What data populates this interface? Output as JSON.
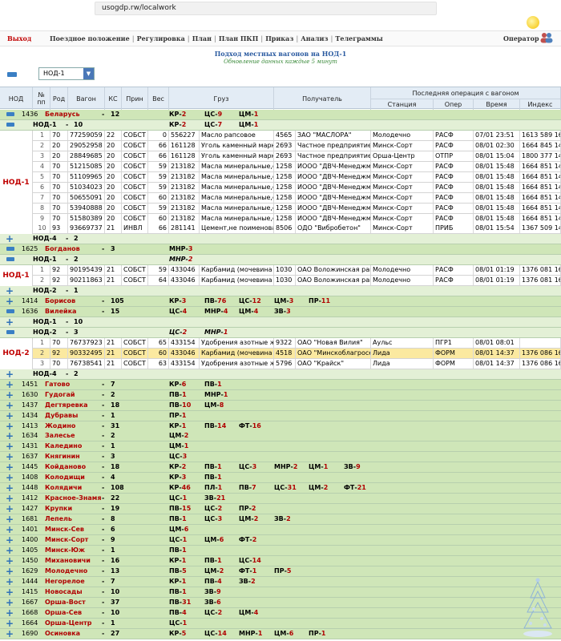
{
  "browser": {
    "url": "usogdp.rw/localwork"
  },
  "menu": {
    "exit": "Выход",
    "items": [
      "Поездное положение",
      "Регулировка",
      "План",
      "План ПКП",
      "Приказ",
      "Анализ",
      "Телеграммы"
    ],
    "operator": "Оператор"
  },
  "header": {
    "title": "Подход местных вагонов на НОД-1",
    "subtitle": "Обновление данных каждые 5 минут",
    "selected_nod": "НОД-1"
  },
  "table": {
    "columns": {
      "nod": "НОД",
      "num": "№ пп",
      "rod": "Род",
      "wagon": "Вагон",
      "ks": "КС",
      "prin": "Прин",
      "ves": "Вес",
      "gruz": "Груз",
      "poluch": "Получатель",
      "last_op": "Последняя операция с вагоном",
      "station": "Станция",
      "oper": "Опер",
      "time": "Время",
      "index": "Индекс"
    }
  },
  "rows": [
    {
      "t": "region",
      "code": "1436",
      "name": "Беларусь",
      "count": "12",
      "ops": [
        {
          "k": "КР",
          "v": "2"
        },
        {
          "k": "ЦС",
          "v": "9"
        },
        {
          "k": "ЦМ",
          "v": "1"
        }
      ],
      "icon": "minus"
    },
    {
      "t": "nodhead",
      "name": "НОД-1",
      "count": "10",
      "ops": [
        {
          "k": "КР",
          "v": "2"
        },
        {
          "k": "ЦС",
          "v": "7"
        },
        {
          "k": "ЦМ",
          "v": "1"
        }
      ],
      "icon": "minus"
    },
    {
      "t": "wag",
      "nod": "НОД-1",
      "n": "1",
      "rod": "70",
      "wagon": "77259059",
      "ks": "22",
      "prin": "СОБСТ",
      "ves": "0",
      "code": "556227",
      "gruz": "Масло рапсовое",
      "pcode": "4565",
      "poluch": "ЗАО \"МАСЛОРА\"",
      "station": "Молодечно",
      "oper": "РАСФ",
      "time": "07/01 23:51",
      "index": "1613 589 16"
    },
    {
      "t": "wag",
      "n": "2",
      "rod": "20",
      "wagon": "29052958",
      "ks": "20",
      "prin": "СОБСТ",
      "ves": "66",
      "code": "161128",
      "gruz": "Уголь каменный марки",
      "pcode": "2693",
      "poluch": "Частное предприятие",
      "station": "Минск-Сорт",
      "oper": "РАСФ",
      "time": "08/01 02:30",
      "index": "1664 845 14"
    },
    {
      "t": "wag",
      "n": "3",
      "rod": "20",
      "wagon": "28849685",
      "ks": "20",
      "prin": "СОБСТ",
      "ves": "66",
      "code": "161128",
      "gruz": "Уголь каменный марки",
      "pcode": "2693",
      "poluch": "Частное предприятие",
      "station": "Орша-Центр",
      "oper": "ОТПР",
      "time": "08/01 15:04",
      "index": "1800 377 14"
    },
    {
      "t": "wag",
      "n": "4",
      "rod": "70",
      "wagon": "51215085",
      "ks": "20",
      "prin": "СОБСТ",
      "ves": "59",
      "code": "213182",
      "gruz": "Масла минеральные,св",
      "pcode": "1258",
      "poluch": "ИООО \"ДВЧ-Менеджме",
      "station": "Минск-Сорт",
      "oper": "РАСФ",
      "time": "08/01 15:48",
      "index": "1664 851 14"
    },
    {
      "t": "wag",
      "n": "5",
      "rod": "70",
      "wagon": "51109965",
      "ks": "20",
      "prin": "СОБСТ",
      "ves": "59",
      "code": "213182",
      "gruz": "Масла минеральные,св",
      "pcode": "1258",
      "poluch": "ИООО \"ДВЧ-Менеджме",
      "station": "Минск-Сорт",
      "oper": "РАСФ",
      "time": "08/01 15:48",
      "index": "1664 851 14"
    },
    {
      "t": "wag",
      "n": "6",
      "rod": "70",
      "wagon": "51034023",
      "ks": "20",
      "prin": "СОБСТ",
      "ves": "59",
      "code": "213182",
      "gruz": "Масла минеральные,св",
      "pcode": "1258",
      "poluch": "ИООО \"ДВЧ-Менеджме",
      "station": "Минск-Сорт",
      "oper": "РАСФ",
      "time": "08/01 15:48",
      "index": "1664 851 14"
    },
    {
      "t": "wag",
      "n": "7",
      "rod": "70",
      "wagon": "50655091",
      "ks": "20",
      "prin": "СОБСТ",
      "ves": "60",
      "code": "213182",
      "gruz": "Масла минеральные,св",
      "pcode": "1258",
      "poluch": "ИООО \"ДВЧ-Менеджме",
      "station": "Минск-Сорт",
      "oper": "РАСФ",
      "time": "08/01 15:48",
      "index": "1664 851 14"
    },
    {
      "t": "wag",
      "n": "8",
      "rod": "70",
      "wagon": "53940888",
      "ks": "20",
      "prin": "СОБСТ",
      "ves": "59",
      "code": "213182",
      "gruz": "Масла минеральные,св",
      "pcode": "1258",
      "poluch": "ИООО \"ДВЧ-Менеджме",
      "station": "Минск-Сорт",
      "oper": "РАСФ",
      "time": "08/01 15:48",
      "index": "1664 851 14"
    },
    {
      "t": "wag",
      "n": "9",
      "rod": "70",
      "wagon": "51580389",
      "ks": "20",
      "prin": "СОБСТ",
      "ves": "60",
      "code": "213182",
      "gruz": "Масла минеральные,св",
      "pcode": "1258",
      "poluch": "ИООО \"ДВЧ-Менеджме",
      "station": "Минск-Сорт",
      "oper": "РАСФ",
      "time": "08/01 15:48",
      "index": "1664 851 14"
    },
    {
      "t": "wag",
      "n": "10",
      "rod": "93",
      "wagon": "93669737",
      "ks": "21",
      "prin": "ИНВЛ",
      "ves": "66",
      "code": "281141",
      "gruz": "Цемент,не поименован",
      "pcode": "8506",
      "poluch": "ОДО \"Вибробетон\"",
      "station": "Минск-Сорт",
      "oper": "ПРИБ",
      "time": "08/01 15:54",
      "index": "1367 509 14"
    },
    {
      "t": "nodhead",
      "name": "НОД-4",
      "count": "2",
      "ops": [],
      "icon": "plus"
    },
    {
      "t": "region",
      "code": "1625",
      "name": "Богданов",
      "count": "3",
      "ops": [
        {
          "k": "МНР",
          "v": "3"
        }
      ],
      "icon": "minus"
    },
    {
      "t": "nodhead",
      "name": "НОД-1",
      "count": "2",
      "ops": [
        {
          "k": "МНР",
          "v": "2",
          "it": true
        }
      ],
      "icon": "minus"
    },
    {
      "t": "wag",
      "nod": "НОД-1",
      "n": "1",
      "rod": "92",
      "wagon": "90195439",
      "ks": "21",
      "prin": "СОБСТ",
      "ves": "59",
      "code": "433046",
      "gruz": "Карбамид (мочевина и",
      "pcode": "1030",
      "poluch": "ОАО Воложинская рай",
      "station": "Молодечно",
      "oper": "РАСФ",
      "time": "08/01 01:19",
      "index": "1376 081 16"
    },
    {
      "t": "wag",
      "n": "2",
      "rod": "92",
      "wagon": "90211863",
      "ks": "21",
      "prin": "СОБСТ",
      "ves": "64",
      "code": "433046",
      "gruz": "Карбамид (мочевина и",
      "pcode": "1030",
      "poluch": "ОАО Воложинская рай",
      "station": "Молодечно",
      "oper": "РАСФ",
      "time": "08/01 01:19",
      "index": "1376 081 16"
    },
    {
      "t": "nodhead",
      "name": "НОД-2",
      "count": "1",
      "ops": [],
      "icon": "plus"
    },
    {
      "t": "region",
      "code": "1414",
      "name": "Борисов",
      "count": "105",
      "ops": [
        {
          "k": "КР",
          "v": "3"
        },
        {
          "k": "ПВ",
          "v": "76"
        },
        {
          "k": "ЦС",
          "v": "12"
        },
        {
          "k": "ЦМ",
          "v": "3"
        },
        {
          "k": "ПР",
          "v": "11"
        }
      ],
      "icon": "plus"
    },
    {
      "t": "region",
      "code": "1636",
      "name": "Вилейка",
      "count": "15",
      "ops": [
        {
          "k": "ЦС",
          "v": "4"
        },
        {
          "k": "МНР",
          "v": "4"
        },
        {
          "k": "ЦМ",
          "v": "4"
        },
        {
          "k": "ЗВ",
          "v": "3"
        }
      ],
      "icon": "minus"
    },
    {
      "t": "nodhead",
      "name": "НОД-1",
      "count": "10",
      "ops": [],
      "icon": "plus"
    },
    {
      "t": "nodhead",
      "name": "НОД-2",
      "count": "3",
      "ops": [
        {
          "k": "ЦС",
          "v": "2",
          "it": true
        },
        {
          "k": "МНР",
          "v": "1",
          "it": true
        }
      ],
      "icon": "minus"
    },
    {
      "t": "wag",
      "nod": "НОД-2",
      "n": "1",
      "rod": "70",
      "wagon": "76737923",
      "ks": "21",
      "prin": "СОБСТ",
      "ves": "65",
      "code": "433154",
      "gruz": "Удобрения азотные жи",
      "pcode": "9322",
      "poluch": "ОАО \"Новая Вилия\"",
      "station": "Аульс",
      "oper": "ПГР1",
      "time": "08/01 08:01",
      "index": ""
    },
    {
      "t": "wag",
      "hl": true,
      "n": "2",
      "rod": "92",
      "wagon": "90332495",
      "ks": "21",
      "prin": "СОБСТ",
      "ves": "60",
      "code": "433046",
      "gruz": "Карбамид (мочевина и",
      "pcode": "4518",
      "poluch": "ОАО \"Минскоблагросе",
      "station": "Лида",
      "oper": "ФОРМ",
      "time": "08/01 14:37",
      "index": "1376 086 16"
    },
    {
      "t": "wag",
      "n": "3",
      "rod": "70",
      "wagon": "76738541",
      "ks": "21",
      "prin": "СОБСТ",
      "ves": "63",
      "code": "433154",
      "gruz": "Удобрения азотные жи",
      "pcode": "5796",
      "poluch": "ОАО \"Крайск\"",
      "station": "Лида",
      "oper": "ФОРМ",
      "time": "08/01 14:37",
      "index": "1376 086 16"
    },
    {
      "t": "nodhead",
      "name": "НОД-4",
      "count": "2",
      "ops": [],
      "icon": "plus"
    },
    {
      "t": "region",
      "code": "1451",
      "name": "Гатово",
      "count": "7",
      "ops": [
        {
          "k": "КР",
          "v": "6"
        },
        {
          "k": "ПВ",
          "v": "1"
        }
      ],
      "icon": "plus"
    },
    {
      "t": "region",
      "code": "1630",
      "name": "Гудогай",
      "count": "2",
      "ops": [
        {
          "k": "ПВ",
          "v": "1"
        },
        {
          "k": "МНР",
          "v": "1"
        }
      ],
      "icon": "plus"
    },
    {
      "t": "region",
      "code": "1437",
      "name": "Дегтяревка",
      "count": "18",
      "ops": [
        {
          "k": "ПВ",
          "v": "10"
        },
        {
          "k": "ЦМ",
          "v": "8"
        }
      ],
      "icon": "plus"
    },
    {
      "t": "region",
      "code": "1434",
      "name": "Дубравы",
      "count": "1",
      "ops": [
        {
          "k": "ПР",
          "v": "1"
        }
      ],
      "icon": "plus"
    },
    {
      "t": "region",
      "code": "1413",
      "name": "Жодино",
      "count": "31",
      "ops": [
        {
          "k": "КР",
          "v": "1"
        },
        {
          "k": "ПВ",
          "v": "14"
        },
        {
          "k": "ФТ",
          "v": "16"
        }
      ],
      "icon": "plus"
    },
    {
      "t": "region",
      "code": "1634",
      "name": "Залесье",
      "count": "2",
      "ops": [
        {
          "k": "ЦМ",
          "v": "2"
        }
      ],
      "icon": "plus"
    },
    {
      "t": "region",
      "code": "1431",
      "name": "Каледино",
      "count": "1",
      "ops": [
        {
          "k": "ЦМ",
          "v": "1"
        }
      ],
      "icon": "plus"
    },
    {
      "t": "region",
      "code": "1637",
      "name": "Княгинин",
      "count": "3",
      "ops": [
        {
          "k": "ЦС",
          "v": "3"
        }
      ],
      "icon": "plus"
    },
    {
      "t": "region",
      "code": "1445",
      "name": "Койданово",
      "count": "18",
      "ops": [
        {
          "k": "КР",
          "v": "2"
        },
        {
          "k": "ПВ",
          "v": "1"
        },
        {
          "k": "ЦС",
          "v": "3"
        },
        {
          "k": "МНР",
          "v": "2"
        },
        {
          "k": "ЦМ",
          "v": "1"
        },
        {
          "k": "ЗВ",
          "v": "9"
        }
      ],
      "icon": "plus"
    },
    {
      "t": "region",
      "code": "1408",
      "name": "Колодищи",
      "count": "4",
      "ops": [
        {
          "k": "КР",
          "v": "3"
        },
        {
          "k": "ПВ",
          "v": "1"
        }
      ],
      "icon": "plus"
    },
    {
      "t": "region",
      "code": "1448",
      "name": "Колядичи",
      "count": "108",
      "ops": [
        {
          "k": "КР",
          "v": "46"
        },
        {
          "k": "ПЛ",
          "v": "1"
        },
        {
          "k": "ПВ",
          "v": "7"
        },
        {
          "k": "ЦС",
          "v": "31"
        },
        {
          "k": "ЦМ",
          "v": "2"
        },
        {
          "k": "ФТ",
          "v": "21"
        }
      ],
      "icon": "plus"
    },
    {
      "t": "region",
      "code": "1412",
      "name": "Красное-Знамя",
      "count": "22",
      "ops": [
        {
          "k": "ЦС",
          "v": "1"
        },
        {
          "k": "ЗВ",
          "v": "21"
        }
      ],
      "icon": "plus"
    },
    {
      "t": "region",
      "code": "1427",
      "name": "Крупки",
      "count": "19",
      "ops": [
        {
          "k": "ПВ",
          "v": "15"
        },
        {
          "k": "ЦС",
          "v": "2"
        },
        {
          "k": "ПР",
          "v": "2"
        }
      ],
      "icon": "plus"
    },
    {
      "t": "region",
      "code": "1681",
      "name": "Лепель",
      "count": "8",
      "ops": [
        {
          "k": "ПВ",
          "v": "1"
        },
        {
          "k": "ЦС",
          "v": "3"
        },
        {
          "k": "ЦМ",
          "v": "2"
        },
        {
          "k": "ЗВ",
          "v": "2"
        }
      ],
      "icon": "plus"
    },
    {
      "t": "region",
      "code": "1401",
      "name": "Минск-Сев",
      "count": "6",
      "ops": [
        {
          "k": "ЦМ",
          "v": "6"
        }
      ],
      "icon": "plus"
    },
    {
      "t": "region",
      "code": "1400",
      "name": "Минск-Сорт",
      "count": "9",
      "ops": [
        {
          "k": "ЦС",
          "v": "1"
        },
        {
          "k": "ЦМ",
          "v": "6"
        },
        {
          "k": "ФТ",
          "v": "2"
        }
      ],
      "icon": "plus"
    },
    {
      "t": "region",
      "code": "1405",
      "name": "Минск-Юж",
      "count": "1",
      "ops": [
        {
          "k": "ПВ",
          "v": "1"
        }
      ],
      "icon": "plus"
    },
    {
      "t": "region",
      "code": "1450",
      "name": "Михановичи",
      "count": "16",
      "ops": [
        {
          "k": "КР",
          "v": "1"
        },
        {
          "k": "ПВ",
          "v": "1"
        },
        {
          "k": "ЦС",
          "v": "14"
        }
      ],
      "icon": "plus"
    },
    {
      "t": "region",
      "code": "1629",
      "name": "Молодечно",
      "count": "13",
      "ops": [
        {
          "k": "ПВ",
          "v": "5"
        },
        {
          "k": "ЦМ",
          "v": "2"
        },
        {
          "k": "ФТ",
          "v": "1"
        },
        {
          "k": "ПР",
          "v": "5"
        }
      ],
      "icon": "plus"
    },
    {
      "t": "region",
      "code": "1444",
      "name": "Негорелое",
      "count": "7",
      "ops": [
        {
          "k": "КР",
          "v": "1"
        },
        {
          "k": "ПВ",
          "v": "4"
        },
        {
          "k": "ЗВ",
          "v": "2"
        }
      ],
      "icon": "plus"
    },
    {
      "t": "region",
      "code": "1415",
      "name": "Новосады",
      "count": "10",
      "ops": [
        {
          "k": "ПВ",
          "v": "1"
        },
        {
          "k": "ЗВ",
          "v": "9"
        }
      ],
      "icon": "plus"
    },
    {
      "t": "region",
      "code": "1667",
      "name": "Орша-Вост",
      "count": "37",
      "ops": [
        {
          "k": "ПВ",
          "v": "31"
        },
        {
          "k": "ЗВ",
          "v": "6"
        }
      ],
      "icon": "plus"
    },
    {
      "t": "region",
      "code": "1668",
      "name": "Орша-Сев",
      "count": "10",
      "ops": [
        {
          "k": "ПВ",
          "v": "4"
        },
        {
          "k": "ЦС",
          "v": "2"
        },
        {
          "k": "ЦМ",
          "v": "4"
        }
      ],
      "icon": "plus"
    },
    {
      "t": "region",
      "code": "1664",
      "name": "Орша-Центр",
      "count": "1",
      "ops": [
        {
          "k": "ЦС",
          "v": "1"
        }
      ],
      "icon": "plus"
    },
    {
      "t": "region",
      "code": "1690",
      "name": "Осиновка",
      "count": "27",
      "ops": [
        {
          "k": "КР",
          "v": "5"
        },
        {
          "k": "ЦС",
          "v": "14"
        },
        {
          "k": "МНР",
          "v": "1"
        },
        {
          "k": "ЦМ",
          "v": "6"
        },
        {
          "k": "ПР",
          "v": "1"
        }
      ],
      "icon": "plus"
    }
  ]
}
